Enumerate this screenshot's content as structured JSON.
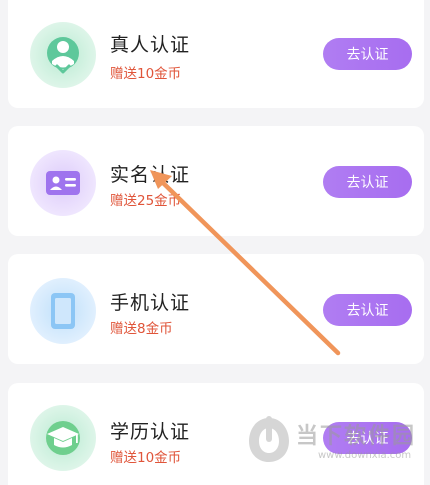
{
  "items": [
    {
      "title": "真人认证",
      "reward": "赠送10金币",
      "button": "去认证",
      "icon": "person-icon"
    },
    {
      "title": "实名认证",
      "reward": "赠送25金币",
      "button": "去认证",
      "icon": "id-card-icon"
    },
    {
      "title": "手机认证",
      "reward": "赠送8金币",
      "button": "去认证",
      "icon": "phone-icon"
    },
    {
      "title": "学历认证",
      "reward": "赠送10金币",
      "button": "去认证",
      "icon": "graduation-cap-icon"
    }
  ],
  "colors": {
    "button": "#a970f0",
    "reward_text": "#e0553a",
    "arrow": "#f0955a"
  },
  "watermark": {
    "text": "当下软件园",
    "url": "www.downxia.com"
  }
}
